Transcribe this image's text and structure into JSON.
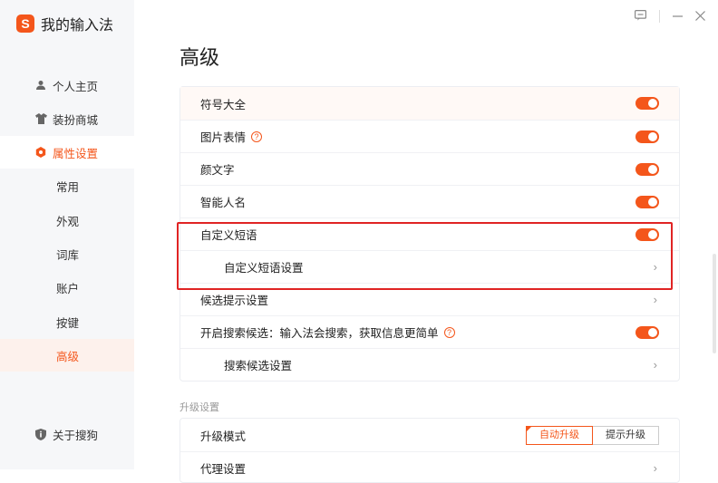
{
  "app": {
    "title": "我的输入法",
    "logo_char": "S"
  },
  "sidebar": {
    "items": [
      {
        "label": "个人主页"
      },
      {
        "label": "装扮商城"
      },
      {
        "label": "属性设置"
      },
      {
        "label": "常用"
      },
      {
        "label": "外观"
      },
      {
        "label": "词库"
      },
      {
        "label": "账户"
      },
      {
        "label": "按键"
      },
      {
        "label": "高级"
      },
      {
        "label": "关于搜狗"
      }
    ]
  },
  "page": {
    "title": "高级"
  },
  "settings": [
    {
      "label": "符号大全",
      "enabled": true
    },
    {
      "label": "图片表情",
      "enabled": true,
      "help": "?"
    },
    {
      "label": "颜文字",
      "enabled": true
    },
    {
      "label": "智能人名",
      "enabled": true
    },
    {
      "label": "自定义短语",
      "enabled": true
    },
    {
      "label": "自定义短语设置"
    },
    {
      "label": "候选提示设置"
    },
    {
      "label": "开启搜索候选：输入法会搜索，获取信息更简单",
      "enabled": true,
      "help": "?"
    },
    {
      "label": "搜索候选设置"
    }
  ],
  "upgrade": {
    "section_label": "升级设置",
    "mode_label": "升级模式",
    "auto_label": "自动升级",
    "prompt_label": "提示升级",
    "selected": "自动升级",
    "next_row_label": "代理设置"
  },
  "colors": {
    "accent": "#f4561b",
    "highlight_border": "#e02424"
  },
  "icons": [
    "person-icon",
    "shirt-icon",
    "settings-hex-icon",
    "info-shield-icon",
    "chat-icon",
    "minimize-icon",
    "close-icon"
  ]
}
